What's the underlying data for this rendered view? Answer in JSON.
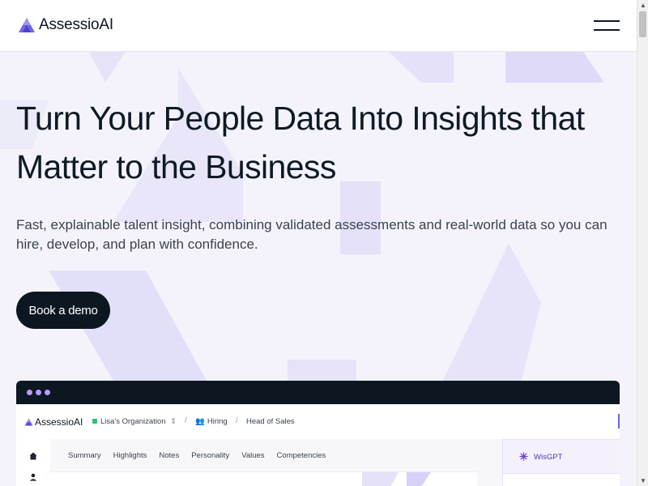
{
  "header": {
    "logo_text": "AssessioAI",
    "menu_icon": "hamburger-menu-icon"
  },
  "hero": {
    "title_line1": "Turn Your People Data Into Insights that",
    "title_line2": "Matter to the Business",
    "subtitle": "Fast, explainable talent insight, combining validated assessments and real-world data so you can hire, develop, and plan with confidence.",
    "cta_label": "Book a demo"
  },
  "mock": {
    "logo_text": "AssessioAI",
    "organization": "Lisa's Organization",
    "breadcrumb_section": "Hiring",
    "breadcrumb_page": "Head of Sales",
    "tabs": [
      "Summary",
      "Highlights",
      "Notes",
      "Personality",
      "Values",
      "Competencies"
    ],
    "assistant_label": "WisGPT"
  },
  "colors": {
    "brand_dark": "#0d1722",
    "accent_purple": "#6f63e8",
    "hero_bg": "#f4f3fb"
  }
}
